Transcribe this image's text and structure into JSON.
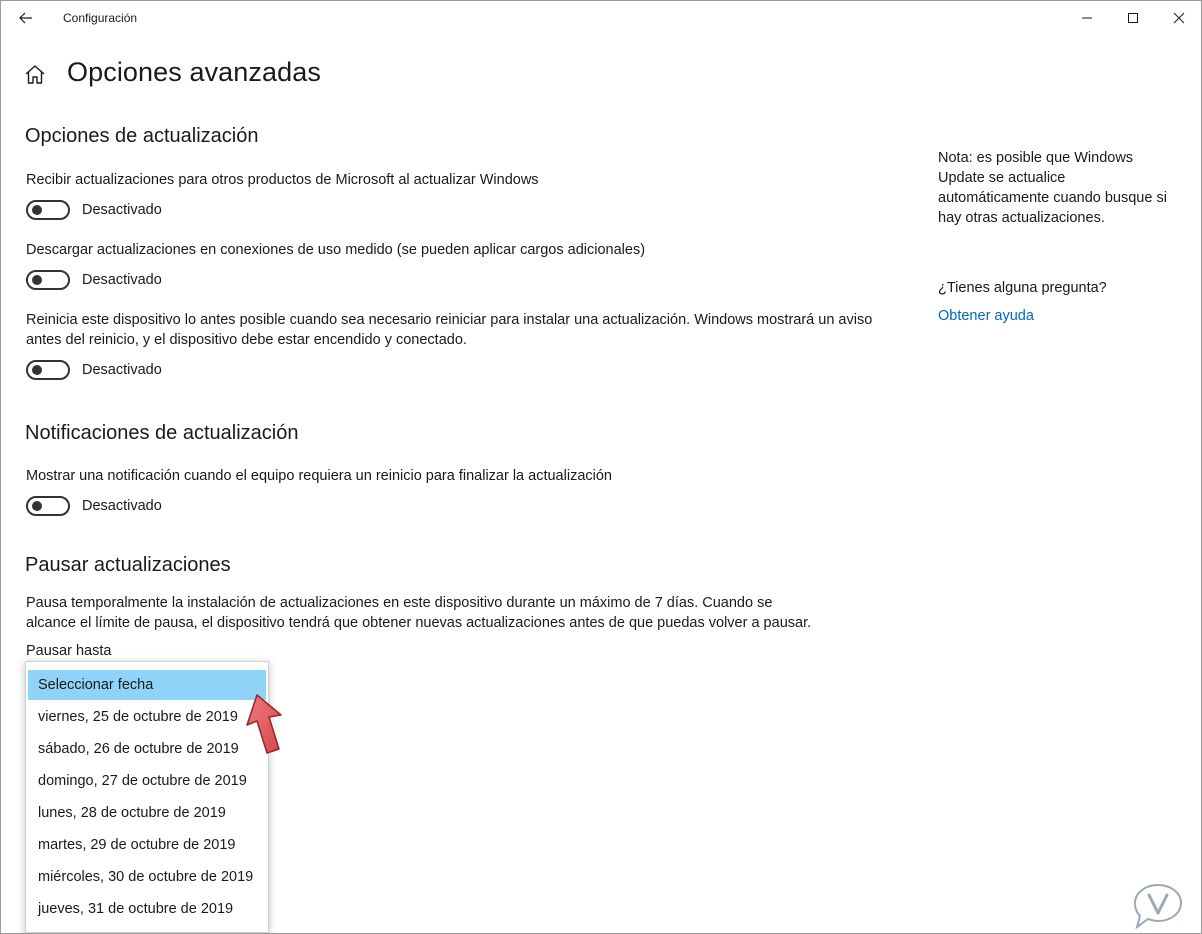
{
  "window": {
    "title": "Configuración"
  },
  "header": {
    "title": "Opciones avanzadas"
  },
  "sections": {
    "update_options": {
      "heading": "Opciones de actualización",
      "settings": [
        {
          "description": "Recibir actualizaciones para otros productos de Microsoft al actualizar Windows",
          "state": "Desactivado"
        },
        {
          "description": "Descargar actualizaciones en conexiones de uso medido (se pueden aplicar cargos adicionales)",
          "state": "Desactivado"
        },
        {
          "description_line1": "Reinicia este dispositivo lo antes posible cuando sea necesario reiniciar para instalar una actualización. Windows mostrará un aviso",
          "description_line2": "antes del reinicio, y el dispositivo debe estar encendido y conectado.",
          "state": "Desactivado"
        }
      ]
    },
    "update_notifications": {
      "heading": "Notificaciones de actualización",
      "setting": {
        "description": "Mostrar una notificación cuando el equipo requiera un reinicio para finalizar la actualización",
        "state": "Desactivado"
      }
    },
    "pause_updates": {
      "heading": "Pausar actualizaciones",
      "description_line1": "Pausa temporalmente la instalación de actualizaciones en este dispositivo durante un máximo de 7 días. Cuando se",
      "description_line2": "alcance el límite de pausa, el dispositivo tendrá que obtener nuevas actualizaciones antes de que puedas volver a pausar.",
      "pause_until_label": "Pausar hasta",
      "options": [
        "Seleccionar fecha",
        "viernes, 25 de octubre de 2019",
        "sábado, 26 de octubre de 2019",
        "domingo, 27 de octubre de 2019",
        "lunes, 28 de octubre de 2019",
        "martes, 29 de octubre de 2019",
        "miércoles, 30 de octubre de 2019",
        "jueves, 31 de octubre de 2019"
      ],
      "selected_option": "Seleccionar fecha"
    }
  },
  "side_panel": {
    "note_line1": "Nota: es posible que Windows",
    "note_line2": "Update se actualice",
    "note_line3": "automáticamente cuando busque si",
    "note_line4": "hay otras actualizaciones.",
    "question": "¿Tienes alguna pregunta?",
    "help_link": "Obtener ayuda"
  },
  "colors": {
    "accent_link": "#0067c0",
    "selection": "#8fd3f8",
    "annotation_arrow": "#e8575a"
  },
  "icons": [
    "back-arrow-icon",
    "minimize-icon",
    "maximize-icon",
    "close-icon",
    "home-icon",
    "pointer-arrow-icon",
    "watermark-logo"
  ]
}
